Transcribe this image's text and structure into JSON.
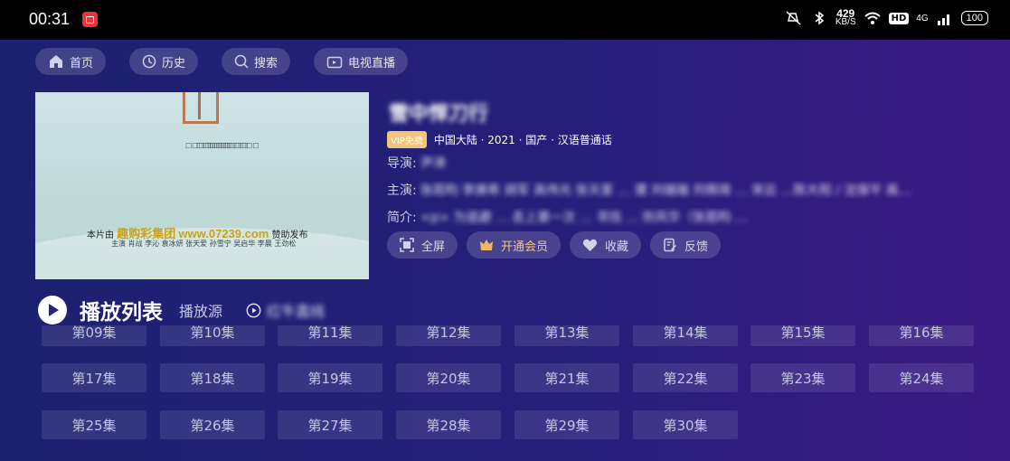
{
  "status": {
    "time": "00:31",
    "net_speed": "429",
    "net_unit": "KB/S",
    "signal": "4G",
    "battery": "100"
  },
  "nav": {
    "home": "首页",
    "history": "历史",
    "search": "搜索",
    "live": "电视直播"
  },
  "poster": {
    "sponsor_prefix": "本片由",
    "sponsor_brand": "趣购彩集团",
    "sponsor_site": "www.07239.com",
    "sponsor_suffix": "赞助发布",
    "credits": "主演  肖战  李沁  袁冰妍  张天爱  孙雪宁  吴启华  李晨  王劲松"
  },
  "detail": {
    "title": "雪中悍刀行",
    "vip_badge": "VIP免费",
    "meta": "中国大陆 · 2021 · 国产 · 汉语普通话",
    "director_label": "导演:",
    "director_value": "尹涛",
    "cast_label": "主演:",
    "cast_value": "张若昀 李庚希 胡军 高伟光 张天爱 … 濮 刘端端 刘佩琦 … 宋云 …陈大阳 / 沈保平 高…",
    "intro_label": "简介:",
    "intro_value": "<p> 为逃避 … 走上第一次 … 寻找 … 你风华（张若昀 …"
  },
  "actions": {
    "fullscreen": "全屏",
    "vip": "开通会员",
    "favorite": "收藏",
    "feedback": "反馈"
  },
  "playlist": {
    "title": "播放列表",
    "source_label": "播放源",
    "line_label": "红牛直线"
  },
  "episodes": [
    "第09集",
    "第10集",
    "第11集",
    "第12集",
    "第13集",
    "第14集",
    "第15集",
    "第16集",
    "第17集",
    "第18集",
    "第19集",
    "第20集",
    "第21集",
    "第22集",
    "第23集",
    "第24集",
    "第25集",
    "第26集",
    "第27集",
    "第28集",
    "第29集",
    "第30集"
  ]
}
